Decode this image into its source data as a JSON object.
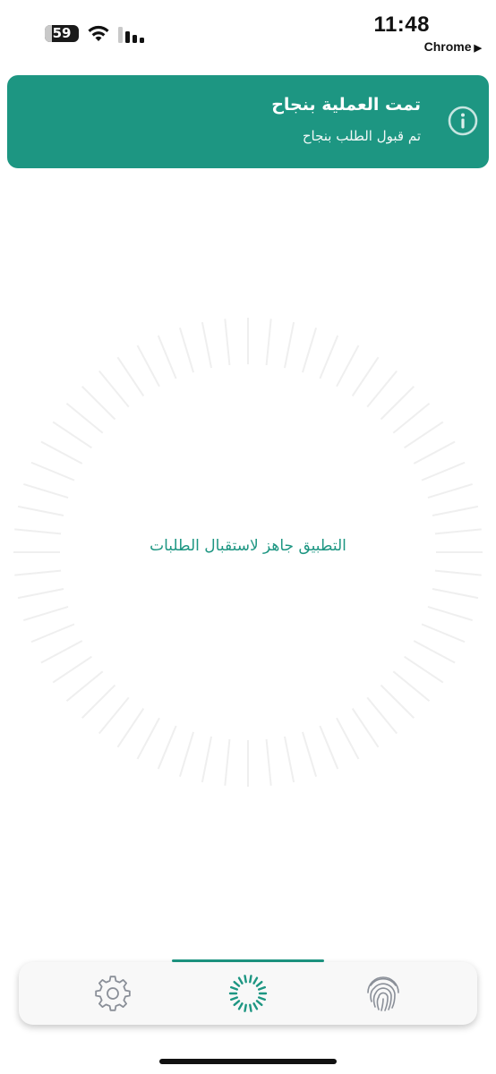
{
  "status_bar": {
    "battery_level": "59",
    "time": "11:48",
    "back_app": "Chrome"
  },
  "notification": {
    "title": "تمت العملية بنجاح",
    "message": "تم قبول الطلب بنجاح",
    "icon": "info-icon"
  },
  "main": {
    "status_text": "التطبيق جاهز لاستقبال الطلبات"
  },
  "tabbar": {
    "tabs": [
      {
        "icon": "gear-icon",
        "active": false
      },
      {
        "icon": "spinner-icon",
        "active": true
      },
      {
        "icon": "fingerprint-icon",
        "active": false
      }
    ]
  },
  "colors": {
    "accent": "#1d9682",
    "banner_text": "#ffffff",
    "ray": "#efefef",
    "inactive_icon": "#8a8f98"
  }
}
